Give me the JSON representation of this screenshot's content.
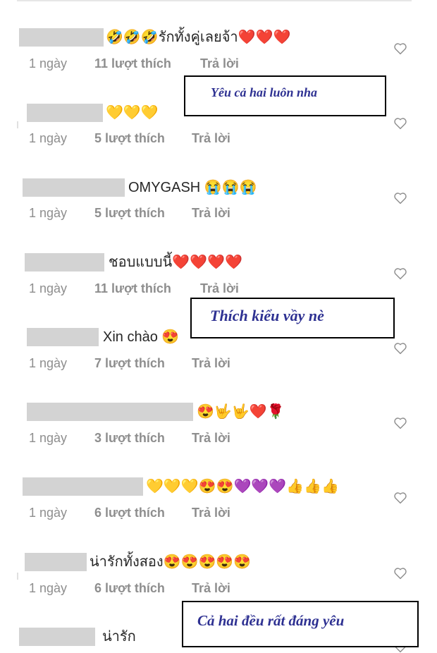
{
  "comments": [
    {
      "text": "🤣🤣🤣รักทั้งคู่เลยจ้า❤️❤️❤️",
      "time": "1 ngày",
      "likes": "11 lượt thích",
      "reply": "Trả lời"
    },
    {
      "text": "💛💛💛",
      "time": "1 ngày",
      "likes": "5 lượt thích",
      "reply": "Trả lời"
    },
    {
      "text": "OMYGASH 😭😭😭",
      "time": "1 ngày",
      "likes": "5 lượt thích",
      "reply": "Trả lời"
    },
    {
      "text": "ชอบแบบนี้❤️❤️❤️❤️",
      "time": "1 ngày",
      "likes": "11 lượt thích",
      "reply": "Trả lời"
    },
    {
      "text": "Xin chào 😍",
      "time": "1 ngày",
      "likes": "7 lượt thích",
      "reply": "Trả lời"
    },
    {
      "text": "😍🤟🤟❤️🌹",
      "time": "1 ngày",
      "likes": "3 lượt thích",
      "reply": "Trả lời"
    },
    {
      "text": "💛💛💛😍😍💜💜💜👍👍👍",
      "time": "1 ngày",
      "likes": "6 lượt thích",
      "reply": "Trả lời"
    },
    {
      "text": "น่ารักทั้งสอง😍😍😍😍😍",
      "time": "1 ngày",
      "likes": "6 lượt thích",
      "reply": "Trả lời"
    },
    {
      "text": "น่ารัก",
      "time": "",
      "likes": "",
      "reply": ""
    }
  ],
  "annotations": [
    {
      "text": "Yêu cả hai luôn nha"
    },
    {
      "text": "Thích kiểu vầy nè"
    },
    {
      "text": "Cả hai đều rất đáng yêu"
    }
  ],
  "icons": {
    "like": "heart-outline-icon"
  },
  "colors": {
    "meta": "#8e8e8e",
    "annotation_text": "#2e3192",
    "name_redaction": "#d3d3d3"
  }
}
